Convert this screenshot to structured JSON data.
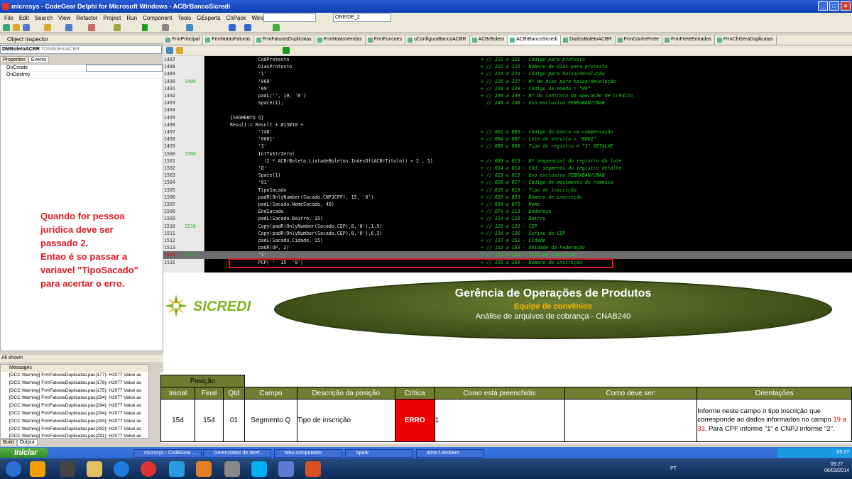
{
  "window": {
    "title": "microsys - CodeGear Delphi for Microsoft Windows - ACBrBancoSicredi"
  },
  "menu": [
    "File",
    "Edit",
    "Search",
    "View",
    "Refactor",
    "Project",
    "Run",
    "Component",
    "Tools",
    "GExperts",
    "CnPack",
    "Window",
    "Help"
  ],
  "toolbar": {
    "desktop_combo": "ONEIDE_2"
  },
  "inspector": {
    "title": "Object Inspector",
    "object": "DMBoletoACBR",
    "object_type": "TDMBoletoACBR",
    "tabs": [
      "Properties",
      "Events"
    ],
    "events": [
      "OnCreate",
      "OnDestroy"
    ],
    "status": "All shown"
  },
  "messages": {
    "title": "Messages",
    "items": [
      "[DCC Warning] FrmFaturasDuplicatas.pas(177): H2077 Value as",
      "[DCC Warning] FrmFaturasDuplicatas.pas(176): H2077 Value as",
      "[DCC Warning] FrmFaturasDuplicatas.pas(175): H2077 Value as",
      "[DCC Warning] FrmFaturasDuplicatas.pas(294): H2077 Value as",
      "[DCC Warning] FrmFaturasDuplicatas.pas(294): H2077 Value as",
      "[DCC Warning] FrmFaturasDuplicatas.pas(294): H2077 Value as",
      "[DCC Warning] FrmFaturasDuplicatas.pas(293): H2077 Value as",
      "[DCC Warning] FrmFaturasDuplicatas.pas(292): H2077 Value as",
      "[DCC Warning] FrmFaturasDuplicatas.pas(291): H2077 Value as"
    ],
    "tabs": [
      "Build",
      "Output"
    ]
  },
  "annotation": "Quando for pessoa\njuridica deve ser\npassado 2.\nEntao é so passar a\nvariavel \"TipoSacado\"\npara acertar o erro.",
  "file_tabs": [
    "FrmPrincipal",
    "FrmNotasFaturas",
    "FrmFaturasDuplicatas",
    "FrmNotasVendas",
    "FrmFuncoes",
    "uConfiguraBancoACBR",
    "ACBrBoleto",
    "ACBrBancoSicredi",
    "DadosBoletoACBR",
    "FrmConheFrete",
    "FrmFreteEntradas",
    "FrmCfrGeraDuplicatas"
  ],
  "code": [
    {
      "n": "1487",
      "m": "",
      "c": "            CodProtesto",
      "k": "+ // 221 a 221 - Código para protesto"
    },
    {
      "n": "1488",
      "m": "",
      "c": "            DiasProtesto",
      "k": "+ // 222 a 223 - Número de dias para protesto"
    },
    {
      "n": "1489",
      "m": "",
      "c": "            '1'",
      "k": "+ // 224 a 224 - Código para baixa/devolução"
    },
    {
      "n": "1490",
      "m": "1490",
      "c": "            '060'",
      "k": "+ // 225 a 227 - Nº de dias para baixa/devolução"
    },
    {
      "n": "1491",
      "m": "",
      "c": "            '09'",
      "k": "+ // 228 a 229 - Código da moeda = \"09\""
    },
    {
      "n": "1492",
      "m": "",
      "c": "            padL('', 10, '0')",
      "k": "+ // 230 a 239 - Nº do contrato da operação de crédito"
    },
    {
      "n": "1493",
      "m": "",
      "c": "            Space(1);",
      "k": "  // 240 a 240 - Uso exclusivo FEBRABAN/CNAB"
    },
    {
      "n": "1494",
      "m": "",
      "c": "",
      "k": ""
    },
    {
      "n": "1495",
      "m": "",
      "c": "  {SEGMENTO Q}",
      "k": ""
    },
    {
      "n": "1496",
      "m": "",
      "c": "  Result:= Result + #13#10 +",
      "k": ""
    },
    {
      "n": "1497",
      "m": "",
      "c": "            '748'",
      "k": "+ // 001 a 003 - Código do banco na compensação"
    },
    {
      "n": "1498",
      "m": "",
      "c": "            '0001'",
      "k": "+ // 004 a 007 - Lote de serviço = \"0001\""
    },
    {
      "n": "1499",
      "m": "",
      "c": "            '3'",
      "k": "+ // 008 a 008 - Tipo de registro = \"3\" DETALHE"
    },
    {
      "n": "1500",
      "m": "1500",
      "c": "            IntToStrZero(",
      "k": ""
    },
    {
      "n": "1501",
      "m": "",
      "c": "              (2 * ACBrBoleto.ListadeBoletos.IndexOf(ACBrTitulo)) + 2 , 5)",
      "k": "+ // 009 a 013 - Nº sequencial do registro do lote"
    },
    {
      "n": "1502",
      "m": "",
      "c": "            'Q'",
      "k": "+ // 014 a 014 - Cód. segmento do registro detalhe"
    },
    {
      "n": "1503",
      "m": "",
      "c": "            Space(1)",
      "k": "+ // 015 a 015 - Uso exclusivo FEBRABAN/CNAB"
    },
    {
      "n": "1504",
      "m": "",
      "c": "            '01'",
      "k": "+ // 016 a 017 - Código de movimento de remessa"
    },
    {
      "n": "1505",
      "m": "",
      "c": "            TipoSacado",
      "k": "+ // 018 a 018 - Tipo de inscrição"
    },
    {
      "n": "1506",
      "m": "",
      "c": "            padR(OnlyNumber(Sacado.CNPJCPF), 15, '0')",
      "k": "+ // 019 a 033 - Número de inscrição"
    },
    {
      "n": "1507",
      "m": "",
      "c": "            padL(Sacado.NomeSacado, 40)",
      "k": "+ // 034 a 073 - Nome"
    },
    {
      "n": "1508",
      "m": "",
      "c": "            EndSacado",
      "k": "+ // 074 a 113 - Endereço"
    },
    {
      "n": "1509",
      "m": "",
      "c": "            padL(Sacado.Bairro, 15)",
      "k": "+ // 114 a 128 - Bairro"
    },
    {
      "n": "1510",
      "m": "1510",
      "c": "            Copy(padR(OnlyNumber(Sacado.CEP),8,'0'),1,5)",
      "k": "+ // 129 a 133 - CEP"
    },
    {
      "n": "1511",
      "m": "",
      "c": "            Copy(padR(OnlyNumber(Sacado.CEP),8,'0'),6,3)",
      "k": "+ // 134 a 136 - Sufixo do CEP"
    },
    {
      "n": "1512",
      "m": "",
      "c": "            padL(Sacado.Cidade, 15)",
      "k": "+ // 137 a 151 - Cidade"
    },
    {
      "n": "1513",
      "m": "",
      "c": "            padR(UF, 2)",
      "k": "+ // 152 a 153 - Unidade da Federação"
    },
    {
      "n": "1514",
      "m": "1514",
      "c": "            '1'",
      "k": "+ // 154 a 154 - Tipo de inscrição"
    },
    {
      "n": "1515",
      "m": "",
      "c": "            PCP(''  15  '0')",
      "k": "+ // 155 a 169 - Número de inscrição"
    }
  ],
  "banner": {
    "logo_text": "SICREDI",
    "title": "Gerência de Operações de Produtos",
    "subtitle": "Equipe de convênios",
    "caption": "Análise de arquivos de cobrança - CNAB240"
  },
  "table": {
    "group_header": "Posição",
    "headers": [
      "Inicial",
      "Final",
      "Qtd",
      "Campo",
      "Descrição da posição",
      "Crítica",
      "Como está preenchido:",
      "Como deve ser:",
      "Orientações"
    ],
    "row": {
      "inicial": "154",
      "final": "154",
      "qtd": "01",
      "campo": "Segmento Q",
      "descricao": "Tipo de inscrição",
      "critica": "ERRO",
      "preenchido": "1",
      "deve_ser": "",
      "orient_a": "Informe neste campo o tipo inscrição que corresponde ao dados informados no campo ",
      "orient_red": "19 a 33",
      "orient_b": ". Para CPF informe \"1\" e CNPJ informe \"2\"."
    }
  },
  "taskbar": {
    "start": "Iniciar",
    "tasks": [
      "microsys - CodeGear ...",
      "Gerenciador de taref...",
      "Meu computador",
      "Spark",
      "aline.f.elmberti"
    ],
    "tray_time": "09:27",
    "lang": "PT",
    "clock_time": "09:27",
    "clock_date": "06/03/2014"
  }
}
